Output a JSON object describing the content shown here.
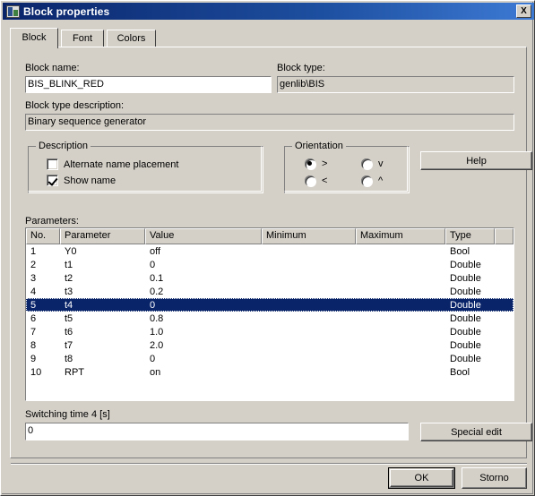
{
  "window": {
    "title": "Block properties",
    "icon": "block-properties-icon",
    "close_label": "X"
  },
  "tabs": [
    {
      "label": "Block",
      "active": true
    },
    {
      "label": "Font",
      "active": false
    },
    {
      "label": "Colors",
      "active": false
    }
  ],
  "fields": {
    "block_name_label": "Block name:",
    "block_name_value": "BIS_BLINK_RED",
    "block_type_label": "Block type:",
    "block_type_value": "genlib\\BIS",
    "block_type_description_label": "Block type description:",
    "block_type_description_value": "Binary sequence generator"
  },
  "description_group": {
    "title": "Description",
    "options": [
      {
        "label": "Alternate name placement",
        "checked": false
      },
      {
        "label": "Show name",
        "checked": true
      }
    ]
  },
  "orientation_group": {
    "title": "Orientation",
    "options": [
      {
        "label": ">",
        "selected": true
      },
      {
        "label": "v",
        "selected": false
      },
      {
        "label": "<",
        "selected": false
      },
      {
        "label": "^",
        "selected": false
      }
    ]
  },
  "help_button": "Help",
  "parameters": {
    "label": "Parameters:",
    "columns": [
      "No.",
      "Parameter",
      "Value",
      "Minimum",
      "Maximum",
      "Type",
      ""
    ],
    "rows": [
      {
        "no": "1",
        "parameter": "Y0",
        "value": "off",
        "minimum": "",
        "maximum": "",
        "type": "Bool",
        "selected": false
      },
      {
        "no": "2",
        "parameter": "t1",
        "value": "0",
        "minimum": "",
        "maximum": "",
        "type": "Double",
        "selected": false
      },
      {
        "no": "3",
        "parameter": "t2",
        "value": "0.1",
        "minimum": "",
        "maximum": "",
        "type": "Double",
        "selected": false
      },
      {
        "no": "4",
        "parameter": "t3",
        "value": "0.2",
        "minimum": "",
        "maximum": "",
        "type": "Double",
        "selected": false
      },
      {
        "no": "5",
        "parameter": "t4",
        "value": "0",
        "minimum": "",
        "maximum": "",
        "type": "Double",
        "selected": true
      },
      {
        "no": "6",
        "parameter": "t5",
        "value": "0.8",
        "minimum": "",
        "maximum": "",
        "type": "Double",
        "selected": false
      },
      {
        "no": "7",
        "parameter": "t6",
        "value": "1.0",
        "minimum": "",
        "maximum": "",
        "type": "Double",
        "selected": false
      },
      {
        "no": "8",
        "parameter": "t7",
        "value": "2.0",
        "minimum": "",
        "maximum": "",
        "type": "Double",
        "selected": false
      },
      {
        "no": "9",
        "parameter": "t8",
        "value": "0",
        "minimum": "",
        "maximum": "",
        "type": "Double",
        "selected": false
      },
      {
        "no": "10",
        "parameter": "RPT",
        "value": "on",
        "minimum": "",
        "maximum": "",
        "type": "Bool",
        "selected": false
      }
    ]
  },
  "editor": {
    "label": "Switching time 4 [s]",
    "value": "0",
    "special_edit_button": "Special edit"
  },
  "footer": {
    "ok_button": "OK",
    "cancel_button": "Storno"
  },
  "colors": {
    "title_bar_start": "#0a246a",
    "title_bar_end": "#3d7ad4",
    "dialog_face": "#d4d0c8",
    "selection": "#0a246a",
    "field_background": "#ffffff"
  }
}
